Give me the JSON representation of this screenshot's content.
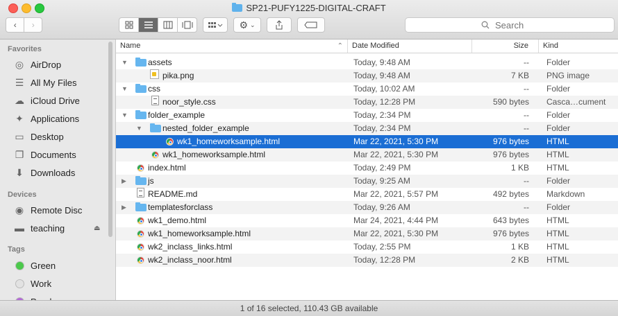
{
  "window": {
    "title": "SP21-PUFY1225-DIGITAL-CRAFT",
    "search_placeholder": "Search"
  },
  "toolbar": {
    "view_modes": [
      "icon-view",
      "list-view",
      "column-view",
      "gallery-view"
    ],
    "active_view": "list-view"
  },
  "sidebar": {
    "favorites_label": "Favorites",
    "favorites": [
      {
        "label": "AirDrop",
        "icon": "airdrop-icon"
      },
      {
        "label": "All My Files",
        "icon": "all-files-icon"
      },
      {
        "label": "iCloud Drive",
        "icon": "cloud-icon"
      },
      {
        "label": "Applications",
        "icon": "applications-icon"
      },
      {
        "label": "Desktop",
        "icon": "desktop-icon"
      },
      {
        "label": "Documents",
        "icon": "documents-icon"
      },
      {
        "label": "Downloads",
        "icon": "downloads-icon"
      }
    ],
    "devices_label": "Devices",
    "devices": [
      {
        "label": "Remote Disc",
        "icon": "disc-icon"
      },
      {
        "label": "teaching",
        "icon": "drive-icon"
      }
    ],
    "tags_label": "Tags",
    "tags": [
      {
        "label": "Green",
        "color": "#4cc94c"
      },
      {
        "label": "Work",
        "color": "#e2e2e2"
      },
      {
        "label": "Purple",
        "color": "#b46ad8"
      }
    ]
  },
  "columns": {
    "name": "Name",
    "date": "Date Modified",
    "size": "Size",
    "kind": "Kind"
  },
  "files": [
    {
      "name": "assets",
      "date": "Today, 9:48 AM",
      "size": "--",
      "kind": "Folder",
      "type": "folder",
      "level": 0,
      "expanded": true
    },
    {
      "name": "pika.png",
      "date": "Today, 9:48 AM",
      "size": "7 KB",
      "kind": "PNG image",
      "type": "img",
      "level": 1
    },
    {
      "name": "css",
      "date": "Today, 10:02 AM",
      "size": "--",
      "kind": "Folder",
      "type": "folder",
      "level": 0,
      "expanded": true
    },
    {
      "name": "noor_style.css",
      "date": "Today, 12:28 PM",
      "size": "590 bytes",
      "kind": "Casca…cument",
      "type": "doc",
      "level": 1
    },
    {
      "name": "folder_example",
      "date": "Today, 2:34 PM",
      "size": "--",
      "kind": "Folder",
      "type": "folder",
      "level": 0,
      "expanded": true
    },
    {
      "name": "nested_folder_example",
      "date": "Today, 2:34 PM",
      "size": "--",
      "kind": "Folder",
      "type": "folder",
      "level": 1,
      "expanded": true
    },
    {
      "name": "wk1_homeworksample.html",
      "date": "Mar 22, 2021, 5:30 PM",
      "size": "976 bytes",
      "kind": "HTML",
      "type": "chrome",
      "level": 2,
      "selected": true
    },
    {
      "name": "wk1_homeworksample.html",
      "date": "Mar 22, 2021, 5:30 PM",
      "size": "976 bytes",
      "kind": "HTML",
      "type": "chrome",
      "level": 1
    },
    {
      "name": "index.html",
      "date": "Today, 2:49 PM",
      "size": "1 KB",
      "kind": "HTML",
      "type": "chrome",
      "level": 0
    },
    {
      "name": "js",
      "date": "Today, 9:25 AM",
      "size": "--",
      "kind": "Folder",
      "type": "folder",
      "level": 0,
      "expanded": false
    },
    {
      "name": "README.md",
      "date": "Mar 22, 2021, 5:57 PM",
      "size": "492 bytes",
      "kind": "Markdown",
      "type": "doc",
      "level": 0
    },
    {
      "name": "templatesforclass",
      "date": "Today, 9:26 AM",
      "size": "--",
      "kind": "Folder",
      "type": "folder",
      "level": 0,
      "expanded": false
    },
    {
      "name": "wk1_demo.html",
      "date": "Mar 24, 2021, 4:44 PM",
      "size": "643 bytes",
      "kind": "HTML",
      "type": "chrome",
      "level": 0
    },
    {
      "name": "wk1_homeworksample.html",
      "date": "Mar 22, 2021, 5:30 PM",
      "size": "976 bytes",
      "kind": "HTML",
      "type": "chrome",
      "level": 0
    },
    {
      "name": "wk2_inclass_links.html",
      "date": "Today, 2:55 PM",
      "size": "1 KB",
      "kind": "HTML",
      "type": "chrome",
      "level": 0
    },
    {
      "name": "wk2_inclass_noor.html",
      "date": "Today, 12:28 PM",
      "size": "2 KB",
      "kind": "HTML",
      "type": "chrome",
      "level": 0
    }
  ],
  "status": "1 of 16 selected, 110.43 GB available"
}
